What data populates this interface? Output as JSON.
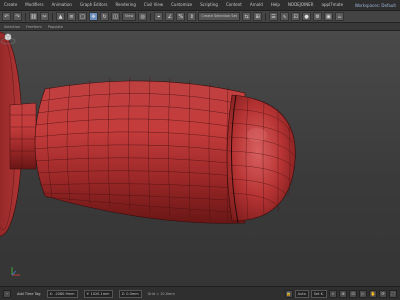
{
  "menubar": {
    "items": [
      "Create",
      "Modifiers",
      "Animation",
      "Graph Editors",
      "Rendering",
      "Civil View",
      "Customize",
      "Scripting",
      "Content",
      "Arnold",
      "Help",
      "NODEJOINER",
      "appl7mate"
    ],
    "workspace": "Workspaces: Default"
  },
  "toolbar": {
    "selection_set": "Create Selection Set",
    "view_mode": "View"
  },
  "ribbon": {
    "items": [
      "Selection",
      "Freeform",
      "Populate"
    ]
  },
  "viewport": {
    "view_label": "",
    "object_color": "#b03232",
    "object_highlight": "#d05050",
    "object_shadow": "#5a1212",
    "background_top": "#4a4a4a",
    "background_bottom": "#353535"
  },
  "statusbar": {
    "status_text": "Add Time Tag",
    "x_value": "X: -2080.9mm",
    "y_value": "Y: 1020.1mm",
    "z_value": "Z: 0.0mm",
    "grid": "Grid = 10.0mm",
    "auto_key": "Auto",
    "set_key": "Set K."
  }
}
